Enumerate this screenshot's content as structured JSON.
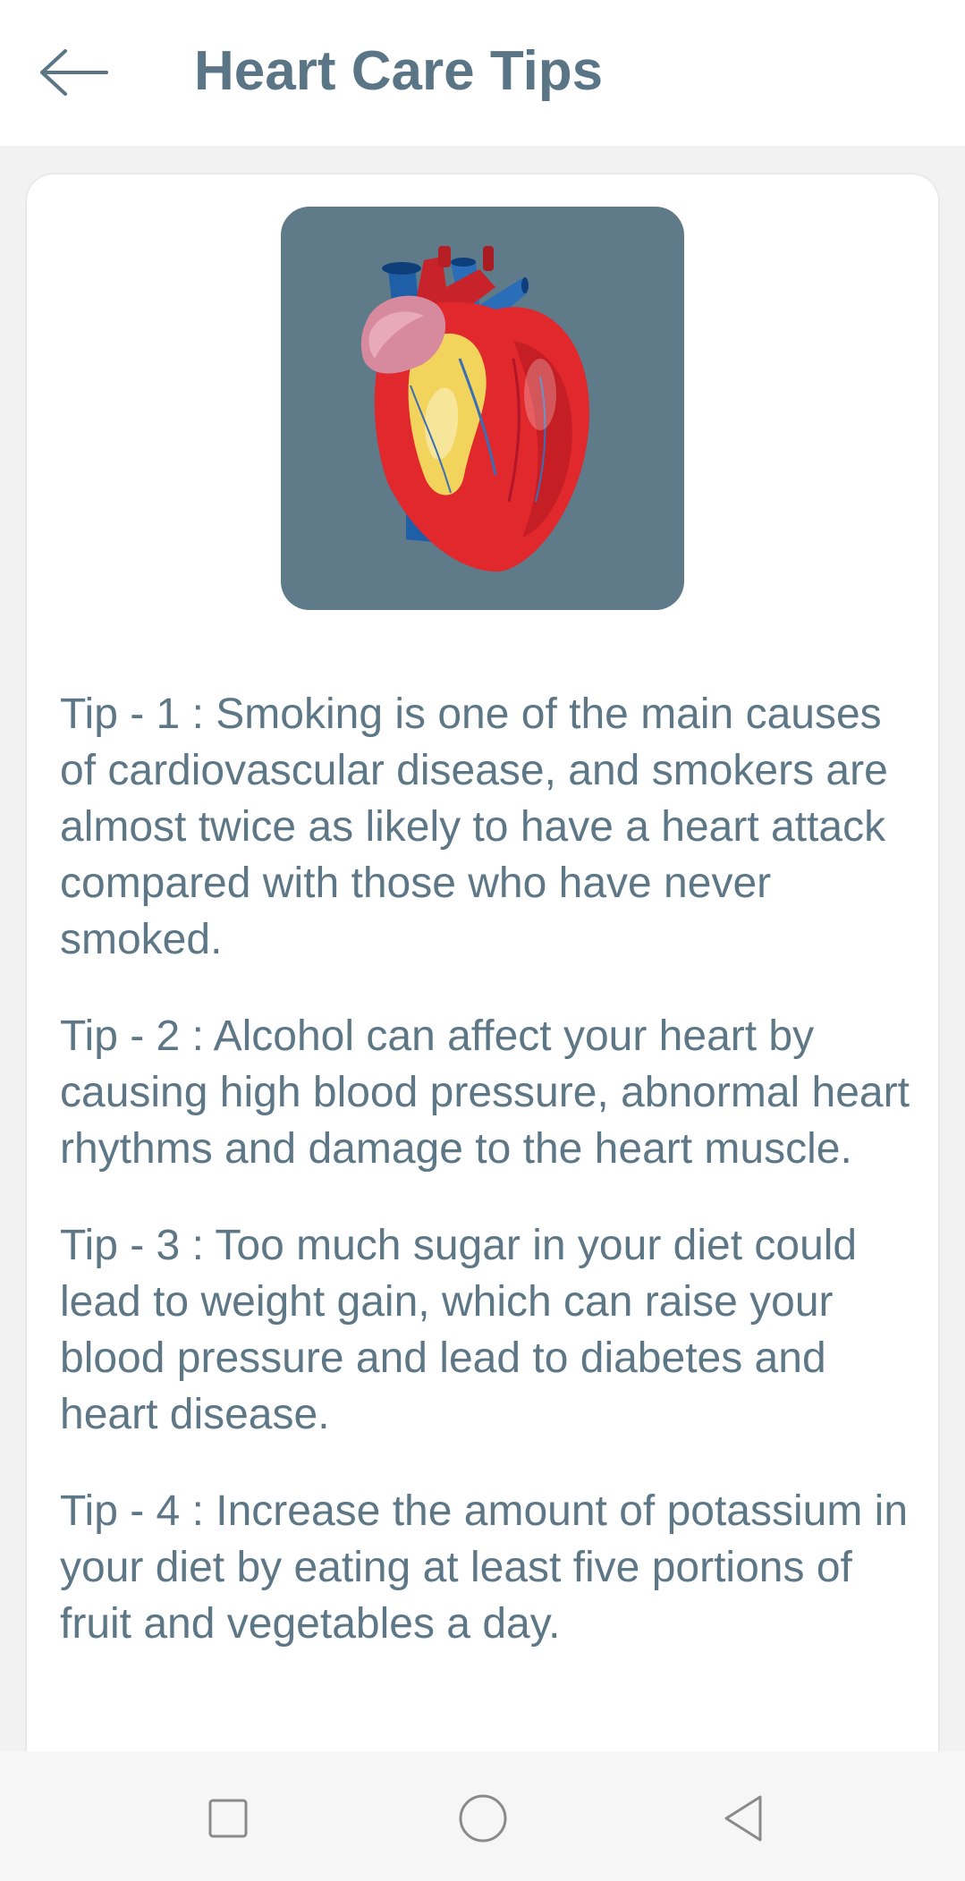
{
  "header": {
    "title": "Heart Care Tips"
  },
  "tips": [
    "Tip - 1 :  Smoking is one of the main causes of cardiovascular disease, and smokers are almost twice as likely to have a heart attack compared with those who have never smoked.",
    "Tip - 2 :  Alcohol can affect your heart by causing high blood pressure, abnormal heart rhythms and damage to the heart muscle.",
    "Tip - 3 :  Too much sugar in your diet could lead to weight gain, which can raise your blood pressure and lead to diabetes and heart disease.",
    "Tip - 4 :  Increase the amount of potassium in your diet by eating at least five portions of fruit and vegetables a day."
  ],
  "icons": {
    "back": "arrow-left-icon",
    "recents": "square-icon",
    "home": "circle-icon",
    "nav_back": "triangle-back-icon"
  },
  "colors": {
    "accent": "#5a7585",
    "image_background": "#5f7a89",
    "text": "#5d7787"
  }
}
